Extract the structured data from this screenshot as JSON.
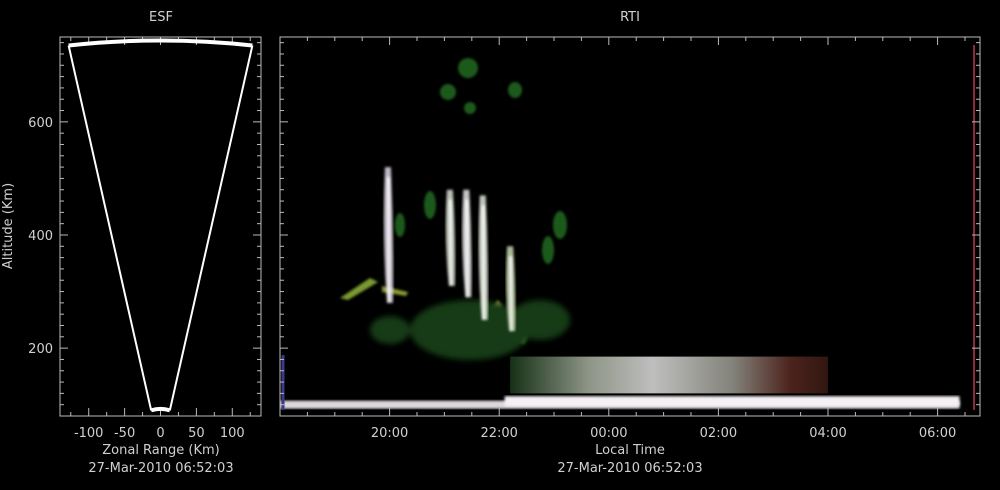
{
  "chart_data": [
    {
      "type": "heatmap",
      "title": "ESF",
      "xlabel": "Zonal Range (Km)",
      "ylabel": "Altitude (Km)",
      "timestamp": "27-Mar-2010 06:52:03",
      "xlim": [
        -140,
        140
      ],
      "ylim": [
        80,
        750
      ],
      "xticks": [
        -100,
        -50,
        0,
        50,
        100
      ],
      "xtick_labels": [
        "-100",
        "-50",
        "0",
        "50",
        "100"
      ],
      "yticks": [
        200,
        400,
        600
      ],
      "ytick_labels": [
        "200",
        "400",
        "600"
      ],
      "beam_sector": {
        "left_edge": [
          [
            -13,
            90
          ],
          [
            -128,
            735
          ]
        ],
        "right_edge": [
          [
            13,
            90
          ],
          [
            128,
            735
          ]
        ],
        "top_arc_altitude": 735,
        "bottom_arc_altitude": 90
      }
    },
    {
      "type": "heatmap",
      "title": "RTI",
      "xlabel": "Local Time",
      "ylabel": "",
      "timestamp": "27-Mar-2010 06:52:03",
      "xlim": [
        18.0,
        24.86
      ],
      "ylim": [
        80,
        750
      ],
      "xticks": [
        20,
        22,
        24,
        26,
        28,
        30
      ],
      "xtick_labels": [
        "20:00",
        "22:00",
        "00:00",
        "02:00",
        "04:00",
        "06:00"
      ],
      "yticks": [
        200,
        400,
        600
      ],
      "echo_plumes": [
        {
          "time": 19.97,
          "alt_bottom": 280,
          "alt_top": 520,
          "color": "#e0d8e8"
        },
        {
          "time": 21.1,
          "alt_bottom": 310,
          "alt_top": 480,
          "color": "#d8e0d0"
        },
        {
          "time": 21.4,
          "alt_bottom": 290,
          "alt_top": 480,
          "color": "#e8e8e8"
        },
        {
          "time": 21.7,
          "alt_bottom": 250,
          "alt_top": 470,
          "color": "#e0e8d8"
        },
        {
          "time": 22.2,
          "alt_bottom": 230,
          "alt_top": 380,
          "color": "#c8d8b0"
        }
      ],
      "layers": [
        {
          "name_hidden": "bottom-layer",
          "t_start": 18.0,
          "t_end": 30.4,
          "alt": 100,
          "color": "#dcd8dc"
        },
        {
          "name_hidden": "valley-layer",
          "t_start": 22.2,
          "t_end": 28.0,
          "alt_bottom": 120,
          "alt_top": 185,
          "color": "#8a8f88"
        }
      ]
    }
  ]
}
